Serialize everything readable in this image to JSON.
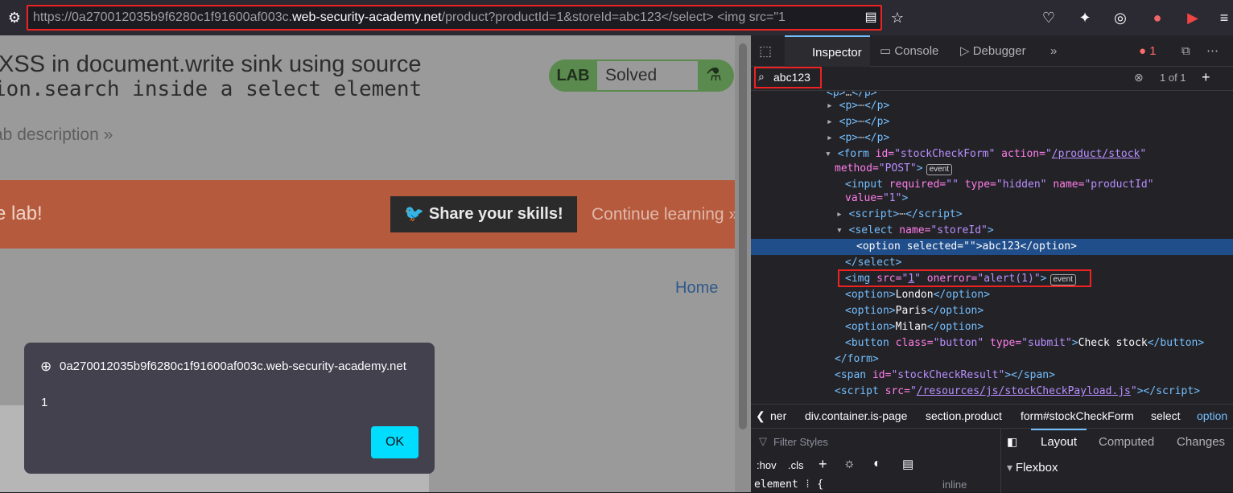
{
  "url": {
    "prefix": "https://0a270012035b9f6280c1f91600af003c.",
    "domain": "web-security-academy.net",
    "suffix": "/product?productId=1&storeId=abc123</select> <img src=\"1"
  },
  "page": {
    "title_line1": "XSS in document.write sink using source",
    "title_line2": "ion.search inside a select element",
    "lab_label": "LAB",
    "lab_status": "Solved",
    "lab_description": "ab description",
    "banner_text": "e lab!",
    "share_button": "Share your skills!",
    "continue_learning": "Continue learning",
    "home_link": "Home"
  },
  "dialog": {
    "host": "0a270012035b9f6280c1f91600af003c.web-security-academy.net",
    "message": "1",
    "ok_label": "OK"
  },
  "devtools": {
    "tabs": [
      "Inspector",
      "Console",
      "Debugger"
    ],
    "error_count": "1",
    "search_value": "abc123",
    "search_count": "1 of 1",
    "markup_lines": [
      {
        "indent": 1,
        "html": "▸ <span class='tag'>&lt;p&gt;</span>…<span class='tag'>&lt;/p&gt;</span>"
      }
    ],
    "breadcrumbs": [
      "ner",
      "div.container.is-page",
      "section.product",
      "form#stockCheckForm",
      "select",
      "option"
    ],
    "filter_styles": "Filter Styles",
    "hov": ":hov",
    "cls": ".cls",
    "layout_tab": "Layout",
    "computed_tab": "Computed",
    "changes_tab": "Changes",
    "flexbox": "Flexbox",
    "element_rule": "element",
    "inline": "inline"
  }
}
